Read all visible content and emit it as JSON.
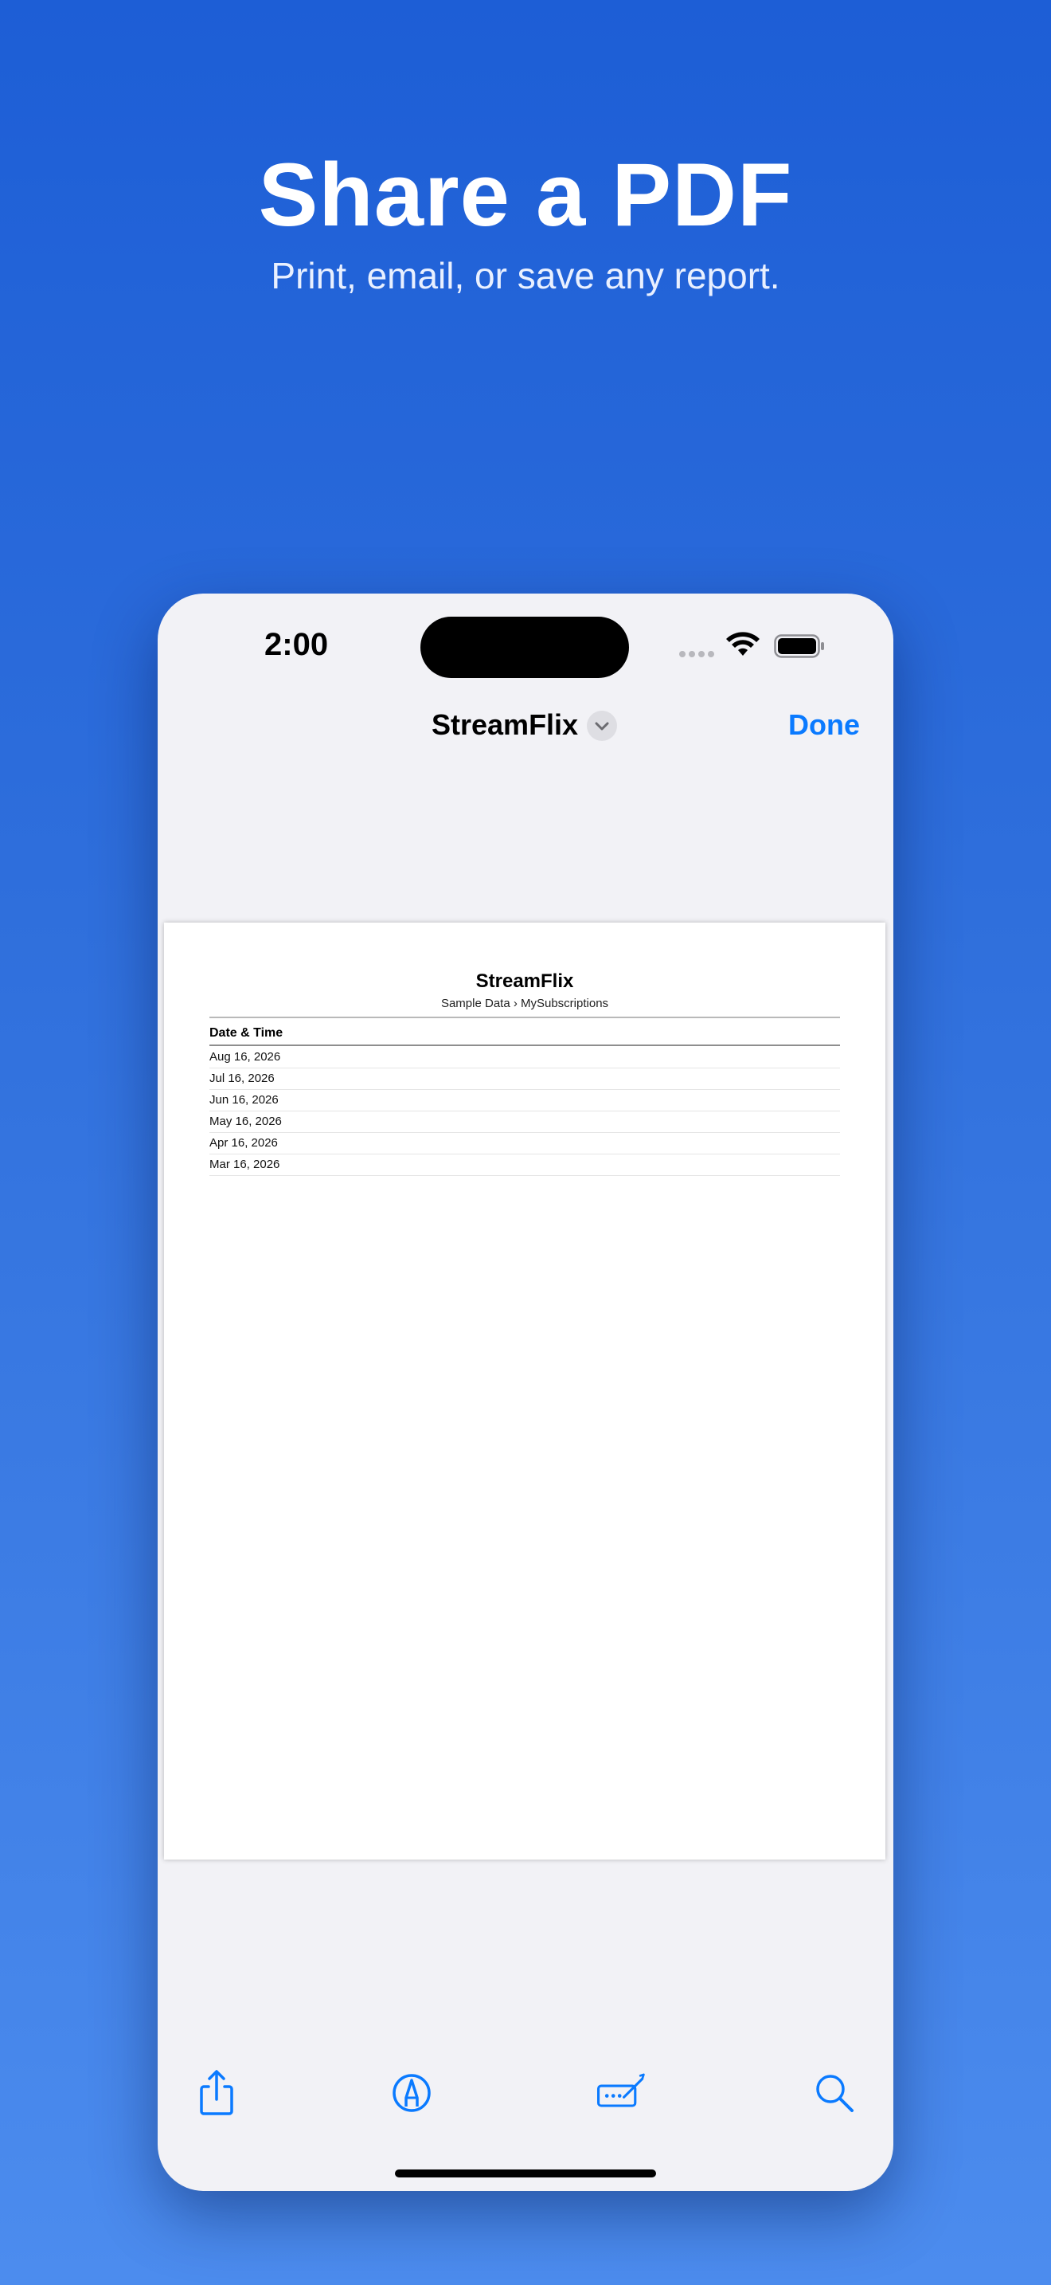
{
  "hero": {
    "title": "Share a PDF",
    "subtitle": "Print, email, or save any report."
  },
  "status_bar": {
    "time": "2:00"
  },
  "nav": {
    "title": "StreamFlix",
    "done_label": "Done"
  },
  "document": {
    "title": "StreamFlix",
    "subtitle": "Sample Data › MySubscriptions",
    "column_header": "Date & Time",
    "rows": [
      "Aug 16, 2026",
      "Jul 16, 2026",
      "Jun 16, 2026",
      "May 16, 2026",
      "Apr 16, 2026",
      "Mar 16, 2026"
    ]
  },
  "toolbar": {
    "icons": [
      "share-icon",
      "markup-icon",
      "signature-icon",
      "search-icon"
    ]
  },
  "colors": {
    "accent": "#0a7aff",
    "background_top": "#1d5ed6",
    "background_bottom": "#4c8cee"
  }
}
